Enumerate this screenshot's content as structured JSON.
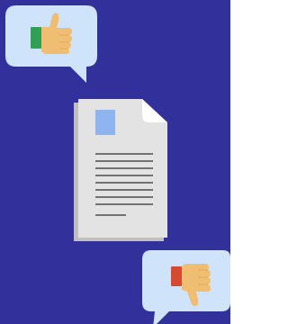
{
  "scene": {
    "background_color": "#32309A",
    "bubble_fill": "#CFE3FB",
    "paper_fill": "#E3E3E3",
    "paper_shadow": "#BFBFBF",
    "paper_fold": "#FFFFFF",
    "image_placeholder": "#8FB4F0",
    "text_line_color": "#727272",
    "skin_color": "#F0BE72",
    "skin_shadow": "#E3AE62",
    "positive_cuff": "#2FA055",
    "negative_cuff": "#D74A32"
  },
  "feedback": {
    "positive_icon": "thumbs-up",
    "negative_icon": "thumbs-down"
  },
  "document": {
    "icon": "text-document"
  }
}
